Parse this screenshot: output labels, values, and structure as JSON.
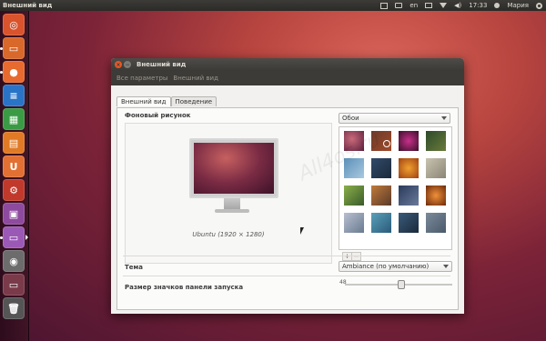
{
  "topbar": {
    "title": "Внешний вид",
    "keyboard": "en",
    "time": "17:33",
    "user": "Мария"
  },
  "launcher": {
    "items": [
      {
        "name": "dash-home",
        "color": "#d9532c",
        "glyph": "◎"
      },
      {
        "name": "files",
        "color": "#d9682b",
        "glyph": "▭"
      },
      {
        "name": "firefox",
        "color": "#e76a2e",
        "glyph": "●"
      },
      {
        "name": "libreoffice-writer",
        "color": "#2a74c7",
        "glyph": "≡"
      },
      {
        "name": "libreoffice-calc",
        "color": "#3a9b45",
        "glyph": "▦"
      },
      {
        "name": "libreoffice-impress",
        "color": "#e07a25",
        "glyph": "▤"
      },
      {
        "name": "ubuntu-software-center",
        "color": "#e27033",
        "glyph": "U"
      },
      {
        "name": "system-settings",
        "color": "#c0392b",
        "glyph": "⚙"
      },
      {
        "name": "workspace-switcher",
        "color": "#8e4a9e",
        "glyph": "▣"
      },
      {
        "name": "appearance",
        "color": "#9b59b6",
        "glyph": "▭"
      },
      {
        "name": "camera",
        "color": "#6c6c6c",
        "glyph": "◉"
      },
      {
        "name": "terminal",
        "color": "#7a3a49",
        "glyph": "▭"
      },
      {
        "name": "trash",
        "color": "#555",
        "glyph": "🗑"
      }
    ]
  },
  "window": {
    "title": "Внешний вид",
    "breadcrumb": [
      "Все параметры",
      "Внешний вид"
    ],
    "tabs": [
      "Внешний вид",
      "Поведение"
    ],
    "wallpaper_label": "Фоновый рисунок",
    "wallpaper_source": "Обои",
    "preview_caption": "Ubuntu (1920 × 1280)",
    "theme_label": "Тема",
    "theme_value": "Ambiance (по умолчанию)",
    "icon_size_label": "Размер значков панели запуска",
    "icon_size_value": "48",
    "add": "+",
    "remove": "−"
  },
  "watermark": "All4os.ru"
}
